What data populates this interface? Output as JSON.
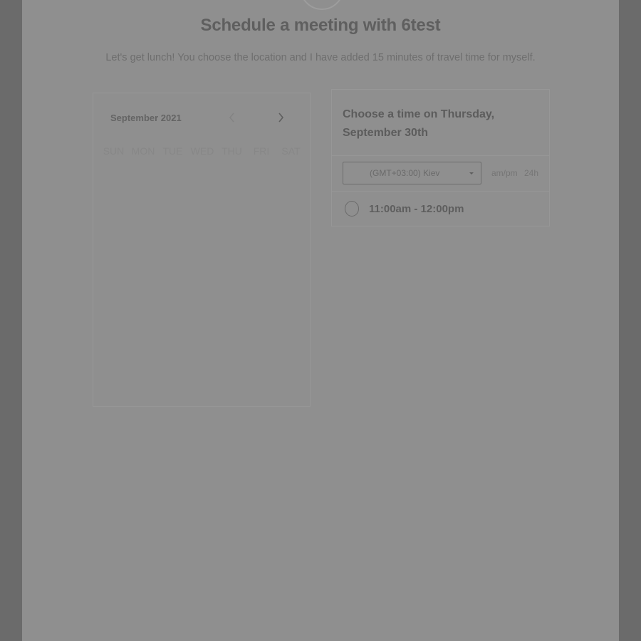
{
  "header": {
    "title": "Schedule a meeting with 6test",
    "description": "Let's get lunch! You choose the location and I have added 15 minutes of travel time for myself."
  },
  "calendar": {
    "month_label": "September 2021",
    "weekdays": [
      "SUN",
      "MON",
      "TUE",
      "WED",
      "THU",
      "FRI",
      "SAT"
    ],
    "prev_icon": "chevron-left-icon",
    "next_icon": "chevron-right-icon"
  },
  "time_panel": {
    "heading": "Choose a time on Thursday, September 30th",
    "timezone": "(GMT+03:00) Kiev",
    "format_ampm": "am/pm",
    "format_24h": "24h",
    "slots": [
      "11:00am - 12:00pm"
    ]
  },
  "colors": {
    "overlay_background": "#6b6b6b",
    "page_background": "#8f8f8f",
    "heading_text": "#5f5f5f"
  }
}
